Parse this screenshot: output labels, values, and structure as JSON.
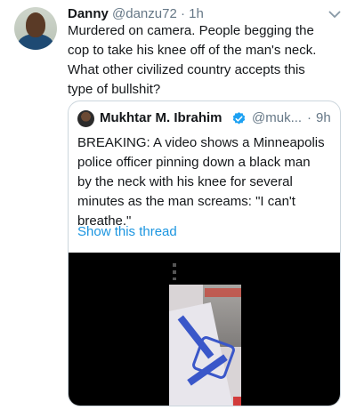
{
  "tweet": {
    "author_name": "Danny",
    "author_handle": "@danzu72",
    "separator": "·",
    "time": "1h",
    "text_lines": [
      "Murdered on camera. People begging the",
      "cop to take his knee off of the man's neck.",
      "What other civilized country accepts this",
      "type of bullshit?"
    ]
  },
  "quoted_tweet": {
    "author_name": "Mukhtar M. Ibrahim",
    "author_handle": "@muk...",
    "separator": "·",
    "time": "9h",
    "text_lines": [
      "BREAKING: A video shows a Minneapolis",
      "police officer pinning down a black man",
      "by the neck with his knee for several",
      "minutes as the man screams: \"I can't",
      "breathe.\""
    ],
    "show_thread_label": "Show this thread"
  },
  "icons": {
    "caret": "chevron-down-icon",
    "verified": "verified-badge-icon"
  },
  "colors": {
    "text": "#14171a",
    "secondary": "#657786",
    "link": "#1b95e0",
    "verified": "#1da1f2",
    "border": "#ccd6dd"
  }
}
